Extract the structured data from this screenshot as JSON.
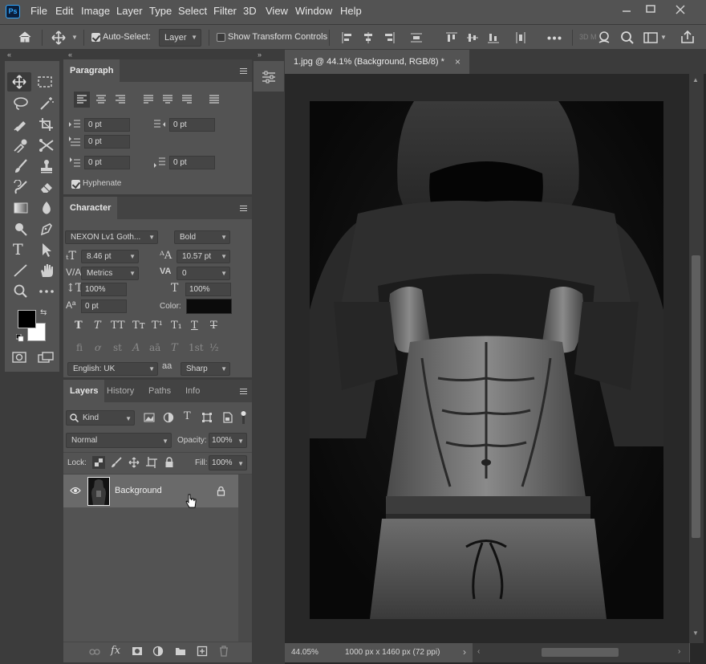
{
  "menubar": {
    "logo": "Ps",
    "items": [
      "File",
      "Edit",
      "Image",
      "Layer",
      "Type",
      "Select",
      "Filter",
      "3D",
      "View",
      "Window",
      "Help"
    ]
  },
  "optionsbar": {
    "auto_select_label": "Auto-Select:",
    "auto_select_checked": true,
    "auto_select_target": "Layer",
    "show_transform_label": "Show Transform Controls",
    "show_transform_checked": false,
    "three_d_label": "3D M"
  },
  "paragraph_panel": {
    "title": "Paragraph",
    "indent_left": "0 pt",
    "indent_right": "0 pt",
    "indent_first": "0 pt",
    "space_before": "0 pt",
    "space_after": "0 pt",
    "hyphenate_label": "Hyphenate",
    "hyphenate_checked": true
  },
  "character_panel": {
    "title": "Character",
    "font_family": "NEXON Lv1 Goth...",
    "font_style": "Bold",
    "font_size": "8.46 pt",
    "leading": "10.57 pt",
    "kerning": "Metrics",
    "tracking": "0",
    "vertical_scale": "100%",
    "horizontal_scale": "100%",
    "baseline_shift": "0 pt",
    "color_label": "Color:",
    "color_value": "#0b0b0b",
    "language": "English: UK",
    "aa_label": "aa",
    "antialias": "Sharp",
    "type_style_buttons": [
      "T",
      "T",
      "TT",
      "Tт",
      "T¹",
      "T₁",
      "T",
      "T"
    ],
    "opentype_buttons": [
      "fi",
      "ơ",
      "st",
      "A",
      "aā",
      "T",
      "1st",
      "½"
    ]
  },
  "layers_panel": {
    "tabs": [
      "Layers",
      "History",
      "Paths",
      "Info"
    ],
    "active_tab": "Layers",
    "filter_kind": "Kind",
    "blend_mode": "Normal",
    "opacity_label": "Opacity:",
    "opacity_value": "100%",
    "lock_label": "Lock:",
    "fill_label": "Fill:",
    "fill_value": "100%",
    "layers": [
      {
        "name": "Background",
        "visible": true,
        "locked": true
      }
    ]
  },
  "document": {
    "tab_title": "1.jpg @ 44.1% (Background, RGB/8) *",
    "zoom": "44.05%",
    "doc_info": "1000 px x 1460 px (72 ppi)"
  },
  "colors": {
    "foreground": "#000000",
    "background": "#ffffff",
    "accent": "#31a8ff"
  }
}
